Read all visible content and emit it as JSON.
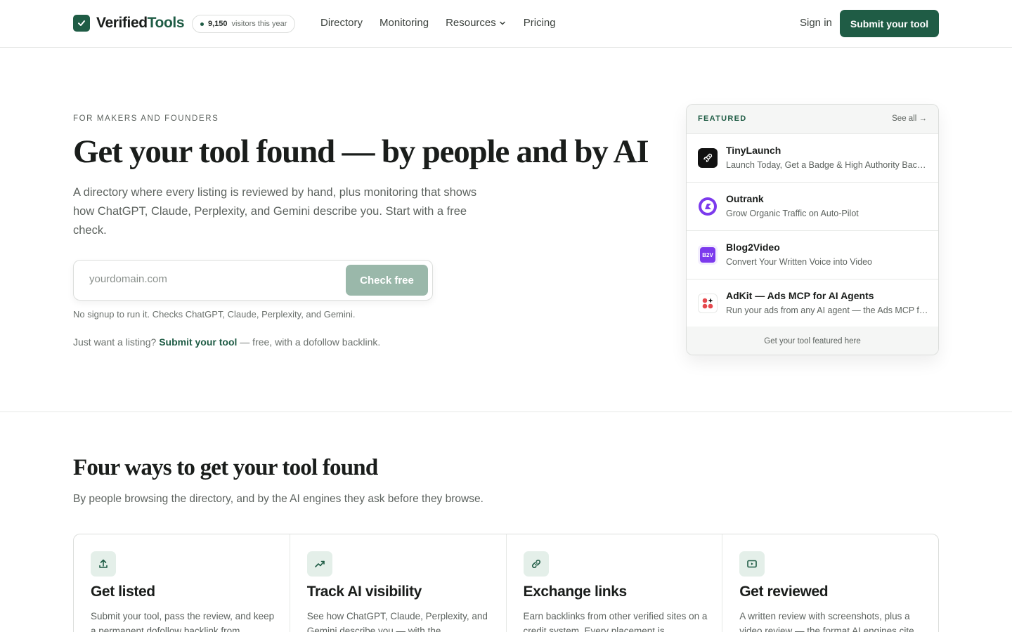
{
  "brand": {
    "name_part1": "Verified",
    "name_part2": "Tools"
  },
  "visitors": {
    "count": "9,150",
    "label": "visitors this year"
  },
  "nav": {
    "links": [
      "Directory",
      "Monitoring",
      "Resources",
      "Pricing"
    ],
    "signin": "Sign in",
    "submit": "Submit your tool"
  },
  "hero": {
    "eyebrow": "FOR MAKERS AND FOUNDERS",
    "title": "Get your tool found — by people and by AI",
    "subtitle": "A directory where every listing is reviewed by hand, plus monitoring that shows how ChatGPT, Claude, Perplexity, and Gemini describe you. Start with a free check.",
    "input_placeholder": "yourdomain.com",
    "check_button": "Check free",
    "note": "No signup to run it. Checks ChatGPT, Claude, Perplexity, and Gemini.",
    "listing_prefix": "Just want a listing?",
    "listing_link": "Submit your tool",
    "listing_suffix": "— free, with a dofollow backlink."
  },
  "featured": {
    "label": "FEATURED",
    "see_all": "See all →",
    "items": [
      {
        "name": "TinyLaunch",
        "desc": "Launch Today, Get a Badge & High Authority Backlinks",
        "icon": "rocket-icon",
        "color": "#111111"
      },
      {
        "name": "Outrank",
        "desc": "Grow Organic Traffic on Auto-Pilot",
        "icon": "outrank-logo-icon",
        "color": "#7c3aed"
      },
      {
        "name": "Blog2Video",
        "desc": "Convert Your Written Voice into Video",
        "icon": "b2v-logo-icon",
        "color": "#7c3aed",
        "icon_text": "B2V"
      },
      {
        "name": "AdKit — Ads MCP for AI Agents",
        "desc": "Run your ads from any AI agent — the Ads MCP for Claude",
        "icon": "adkit-logo-icon",
        "color": "#e5484d"
      }
    ],
    "footer": "Get your tool featured here"
  },
  "section": {
    "title": "Four ways to get your tool found",
    "subtitle": "By people browsing the directory, and by the AI engines they ask before they browse.",
    "cards": [
      {
        "title": "Get listed",
        "desc": "Submit your tool, pass the review, and keep a permanent dofollow backlink from",
        "icon": "upload-icon"
      },
      {
        "title": "Track AI visibility",
        "desc": "See how ChatGPT, Claude, Perplexity, and Gemini describe you — with the",
        "icon": "trending-up-icon"
      },
      {
        "title": "Exchange links",
        "desc": "Earn backlinks from other verified sites on a credit system. Every placement is",
        "icon": "link-icon"
      },
      {
        "title": "Get reviewed",
        "desc": "A written review with screenshots, plus a video review — the format AI engines cite",
        "icon": "video-icon"
      }
    ]
  },
  "colors": {
    "accent": "#1f5c45",
    "accent_light": "#e4efe9",
    "button_disabled": "#9ab8aa"
  }
}
